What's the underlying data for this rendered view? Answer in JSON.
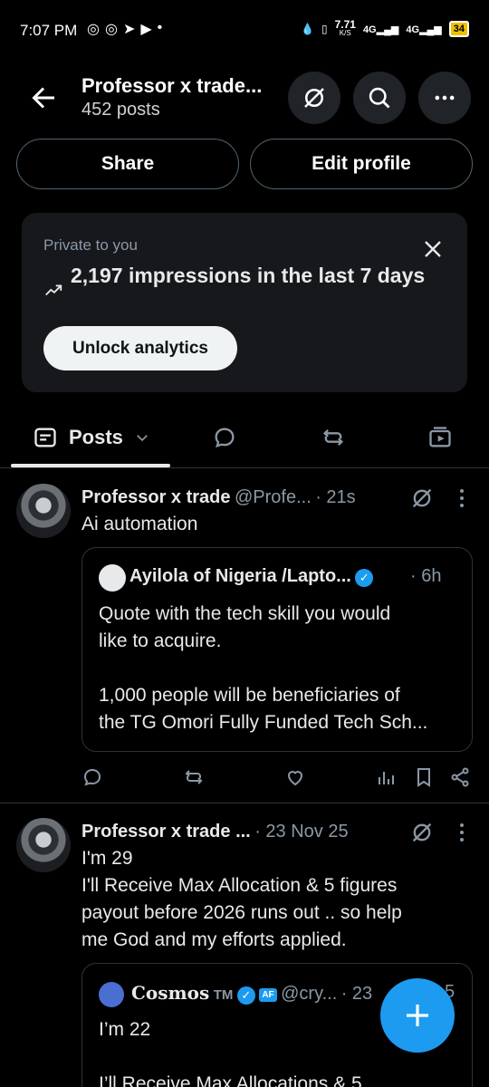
{
  "status": {
    "time": "7:07 PM",
    "speed": "7.71",
    "speed_unit": "K/S",
    "net1": "4G",
    "net2": "4G",
    "battery": "34"
  },
  "header": {
    "title": "Professor x trade...",
    "posts_count": "452 posts"
  },
  "actions": {
    "share": "Share",
    "edit_profile": "Edit profile"
  },
  "analytics": {
    "private_label": "Private to you",
    "impressions": "2,197 impressions in the last 7 days",
    "unlock": "Unlock analytics"
  },
  "tabs": {
    "posts": "Posts"
  },
  "tweet1": {
    "name": "Professor x trade",
    "handle": "@Profe...",
    "time": "· 21s",
    "text": "Ai automation",
    "quote": {
      "name": "Ayilola of Nigeria /Lapto...",
      "time": "· 6h",
      "line1": "Quote with the tech skill you would",
      "line2": "like to acquire.",
      "line3": "1,000 people will be beneficiaries of",
      "line4": "the TG Omori Fully Funded Tech Sch..."
    }
  },
  "tweet2": {
    "name": "Professor x trade ...",
    "time": "· 23 Nov 25",
    "line1": "I'm 29",
    "line2": "I'll Receive Max Allocation & 5 figures",
    "line3": "payout before 2026 runs out ..  so help",
    "line4": "me God and my efforts applied.",
    "quote": {
      "name": "Cosmos",
      "tm": "TM",
      "af": "AF",
      "handle": "@cry...",
      "time": "· 23",
      "time_tail": "5",
      "line1": "I’m 22",
      "line2": "I’ll Receive Max Allocations & 5"
    }
  },
  "colors": {
    "accent": "#1d9bf0",
    "background": "#000000",
    "card": "#16181c"
  }
}
